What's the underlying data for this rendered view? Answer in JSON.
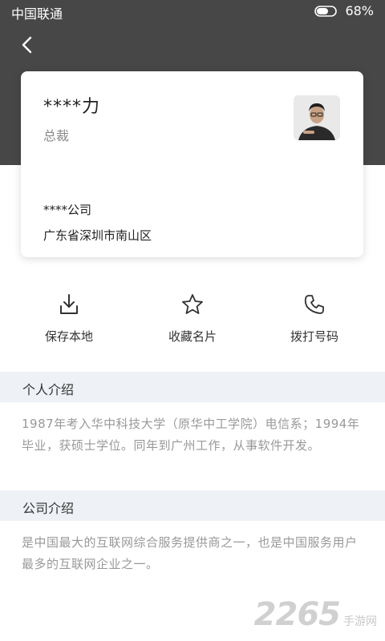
{
  "status_bar": {
    "carrier": "中国联通",
    "battery": "68%"
  },
  "nav": {
    "back_icon": "chevron-left-icon"
  },
  "card": {
    "name": "****力",
    "title": "总裁",
    "company": "****公司",
    "address": "广东省深圳市南山区"
  },
  "actions": [
    {
      "label": "保存本地",
      "icon": "download-icon"
    },
    {
      "label": "收藏名片",
      "icon": "star-icon"
    },
    {
      "label": "拨打号码",
      "icon": "phone-icon"
    }
  ],
  "personal": {
    "heading": "个人介绍",
    "text": "1987年考入华中科技大学（原华中工学院）电信系；1994年毕业，获硕士学位。同年到广州工作，从事软件开发。"
  },
  "company_intro": {
    "heading": "公司介绍",
    "text": "是中国最大的互联网综合服务提供商之一，也是中国服务用户最多的互联网企业之一。"
  },
  "watermark": {
    "number": "2265",
    "text": "手游网"
  },
  "colors": {
    "header": "#474747",
    "section_bg": "#eef1f5",
    "muted_text": "#999999"
  }
}
